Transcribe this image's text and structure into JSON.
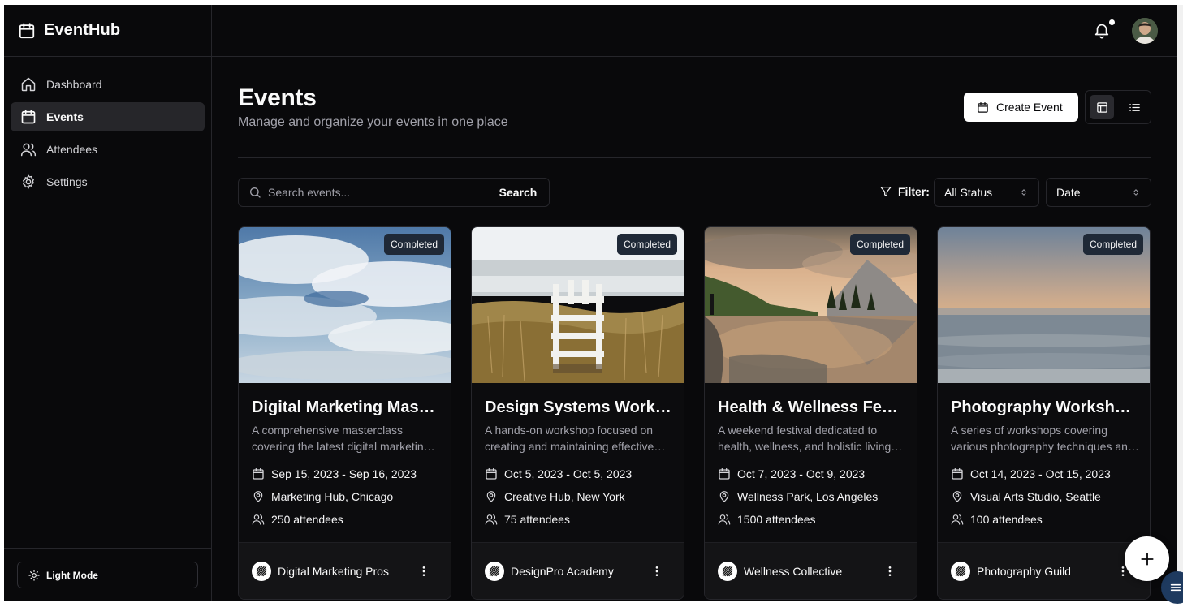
{
  "app": {
    "name": "EventHub"
  },
  "sidebar": {
    "items": [
      {
        "label": "Dashboard",
        "icon": "home-icon",
        "active": false
      },
      {
        "label": "Events",
        "icon": "calendar-icon",
        "active": true
      },
      {
        "label": "Attendees",
        "icon": "users-icon",
        "active": false
      },
      {
        "label": "Settings",
        "icon": "gear-icon",
        "active": false
      }
    ],
    "theme_toggle_label": "Light Mode"
  },
  "header": {
    "notifications_unread": true
  },
  "page": {
    "title": "Events",
    "subtitle": "Manage and organize your events in one place",
    "create_label": "Create Event",
    "view_mode": "grid"
  },
  "search": {
    "placeholder": "Search events...",
    "button_label": "Search"
  },
  "filters": {
    "label": "Filter:",
    "status_value": "All Status",
    "sort_value": "Date"
  },
  "events": [
    {
      "status": "Completed",
      "title": "Digital Marketing Masterclass",
      "description": "A comprehensive masterclass covering the latest digital marketing strategies and tools.",
      "date": "Sep 15, 2023 - Sep 16, 2023",
      "location": "Marketing Hub, Chicago",
      "attendees": "250 attendees",
      "organizer": "Digital Marketing Pros",
      "image": "sky-clouds"
    },
    {
      "status": "Completed",
      "title": "Design Systems Workshop",
      "description": "A hands-on workshop focused on creating and maintaining effective design systems.",
      "date": "Oct 5, 2023 - Oct 5, 2023",
      "location": "Creative Hub, New York",
      "attendees": "75 attendees",
      "organizer": "DesignPro Academy",
      "image": "beach-lifeguard-chair"
    },
    {
      "status": "Completed",
      "title": "Health & Wellness Festival",
      "description": "A weekend festival dedicated to health, wellness, and holistic living practices.",
      "date": "Oct 7, 2023 - Oct 9, 2023",
      "location": "Wellness Park, Los Angeles",
      "attendees": "1500 attendees",
      "organizer": "Wellness Collective",
      "image": "mountain-lake-sunset"
    },
    {
      "status": "Completed",
      "title": "Photography Workshop Series",
      "description": "A series of workshops covering various photography techniques and styles.",
      "date": "Oct 14, 2023 - Oct 15, 2023",
      "location": "Visual Arts Studio, Seattle",
      "attendees": "100 attendees",
      "organizer": "Photography Guild",
      "image": "ocean-sunset"
    }
  ],
  "colors": {
    "background": "#09090b",
    "border": "#26262b",
    "muted_text": "#a1a1aa",
    "badge_bg": "#1f2937",
    "active_nav": "#26262a"
  }
}
